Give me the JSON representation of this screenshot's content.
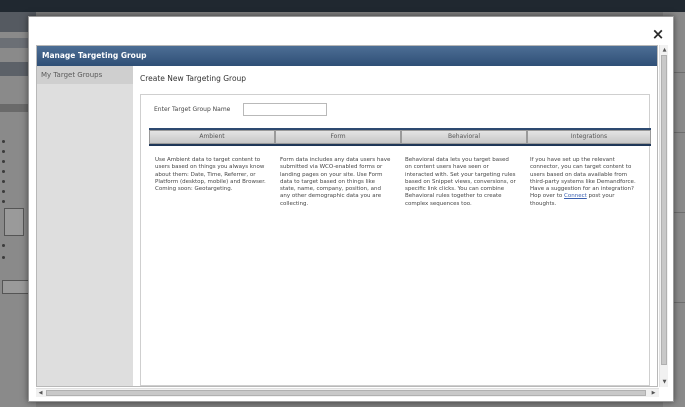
{
  "modal": {
    "close_glyph": "×",
    "title": "Manage Targeting Group",
    "sidebar": {
      "items": [
        {
          "label": "My Target Groups"
        }
      ]
    },
    "main": {
      "title": "Create New Targeting Group",
      "name_field": {
        "label": "Enter Target Group Name",
        "value": "",
        "placeholder": ""
      },
      "tabs": [
        {
          "label": "Ambient"
        },
        {
          "label": "Form"
        },
        {
          "label": "Behavioral"
        },
        {
          "label": "Integrations"
        }
      ],
      "descriptions": {
        "ambient": "Use Ambient data to target content to users based on things you always know about them: Date, Time, Referrer, or Platform (desktop, mobile) and Browser. Coming soon: Geotargeting.",
        "form": "Form data includes any data users have submitted via WCO-enabled forms or landing pages on your site. Use Form data to target based on things like state, name, company, position, and any other demographic data you are collecting.",
        "behavioral": "Behavioral data lets you target based on content users have seen or interacted with. Set your targeting rules based on Snippet views, conversions, or specific link clicks. You can combine Behavioral rules together to create complex sequences too.",
        "integrations_before": "If you have set up the relevant connector, you can target content to users based on data available from third-party systems like Demandforce. Have a suggestion for an integration? Hop over to ",
        "integrations_link": "Connect",
        "integrations_after": " post your thoughts."
      }
    }
  },
  "icons": {
    "close": "close-icon",
    "scroll_up": "scroll-up-icon",
    "scroll_down": "scroll-down-icon",
    "scroll_left": "scroll-left-icon",
    "scroll_right": "scroll-right-icon"
  },
  "colors": {
    "titlebar": "#2f4f76",
    "tabbar": "#1e3556",
    "link": "#3a5fb0"
  }
}
